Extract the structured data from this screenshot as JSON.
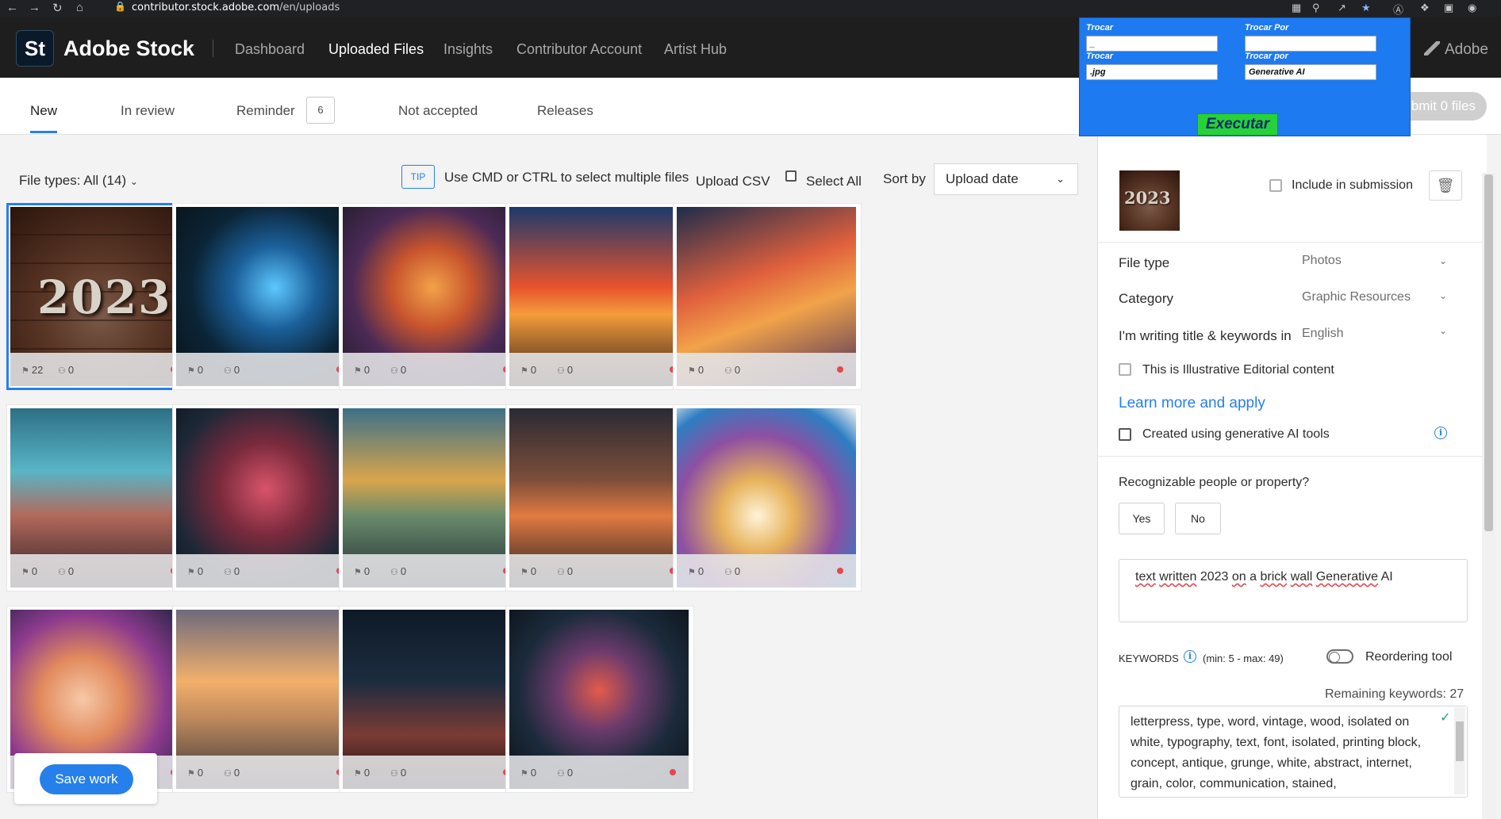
{
  "browser": {
    "url_host": "contributor.stock.adobe.com",
    "url_path": "/en/uploads"
  },
  "app": {
    "logo": "St",
    "brand": "Adobe Stock",
    "nav": [
      "Dashboard",
      "Uploaded Files",
      "Insights",
      "Contributor Account",
      "Artist Hub"
    ],
    "active_nav": "Uploaded Files",
    "adobe_label": "Adobe"
  },
  "tabs": {
    "items": [
      "New",
      "In review",
      "Reminder",
      "Not accepted",
      "Releases"
    ],
    "reminder_count": "6",
    "submit_label": "Submit 0 files"
  },
  "toolbar": {
    "file_types": "File types: All (14)",
    "tip_badge": "TIP",
    "tip_text": "Use CMD or CTRL to select multiple files",
    "upload_csv": "Upload CSV",
    "select_all": "Select All",
    "sort_by": "Sort by",
    "sort_value": "Upload date"
  },
  "files": [
    {
      "keywords": "22",
      "people": "0",
      "selected": true,
      "overlay": "2023"
    },
    {
      "keywords": "0",
      "people": "0"
    },
    {
      "keywords": "0",
      "people": "0"
    },
    {
      "keywords": "0",
      "people": "0"
    },
    {
      "keywords": "0",
      "people": "0"
    },
    {
      "keywords": "0",
      "people": "0"
    },
    {
      "keywords": "0",
      "people": "0"
    },
    {
      "keywords": "0",
      "people": "0"
    },
    {
      "keywords": "0",
      "people": "0"
    },
    {
      "keywords": "0",
      "people": "0"
    },
    {
      "keywords": "0",
      "people": "0"
    },
    {
      "keywords": "0",
      "people": "0"
    },
    {
      "keywords": "0",
      "people": "0"
    },
    {
      "keywords": "0",
      "people": "0"
    }
  ],
  "save_work": "Save work",
  "panel": {
    "thumb_overlay": "2023",
    "include_label": "Include in submission",
    "file_type_label": "File type",
    "file_type_value": "Photos",
    "category_label": "Category",
    "category_value": "Graphic Resources",
    "language_label": "I'm writing title & keywords in",
    "language_value": "English",
    "editorial_label": "This is Illustrative Editorial content",
    "learn_more": "Learn more and apply",
    "genai_label": "Created using generative AI tools",
    "people_question": "Recognizable people or property?",
    "yes": "Yes",
    "no": "No",
    "title_words": [
      "text",
      "written",
      "2023",
      "on",
      "a",
      "brick",
      "wall",
      "Generative",
      "AI"
    ],
    "keywords_label": "KEYWORDS",
    "keywords_range": "(min: 5 - max: 49)",
    "reorder_label": "Reordering tool",
    "remaining": "Remaining keywords: 27",
    "keywords_text": "letterpress, type, word, vintage, wood, isolated on white, typography, text, font, isolated, printing block, concept, antique, grunge, white, abstract, internet, grain, color, communication, stained,"
  },
  "popup": {
    "label1": "Trocar",
    "label2": "Trocar Por",
    "label3": "Trocar",
    "label4": "Trocar por",
    "input1": "_",
    "input2": "",
    "input3": ".jpg",
    "input4": "Generative AI",
    "execute": "Executar"
  },
  "colors": {
    "accent": "#2680eb",
    "status_dot": "#e34850",
    "popup_bg": "#1e7af0",
    "execute_bg": "#27d13a"
  }
}
